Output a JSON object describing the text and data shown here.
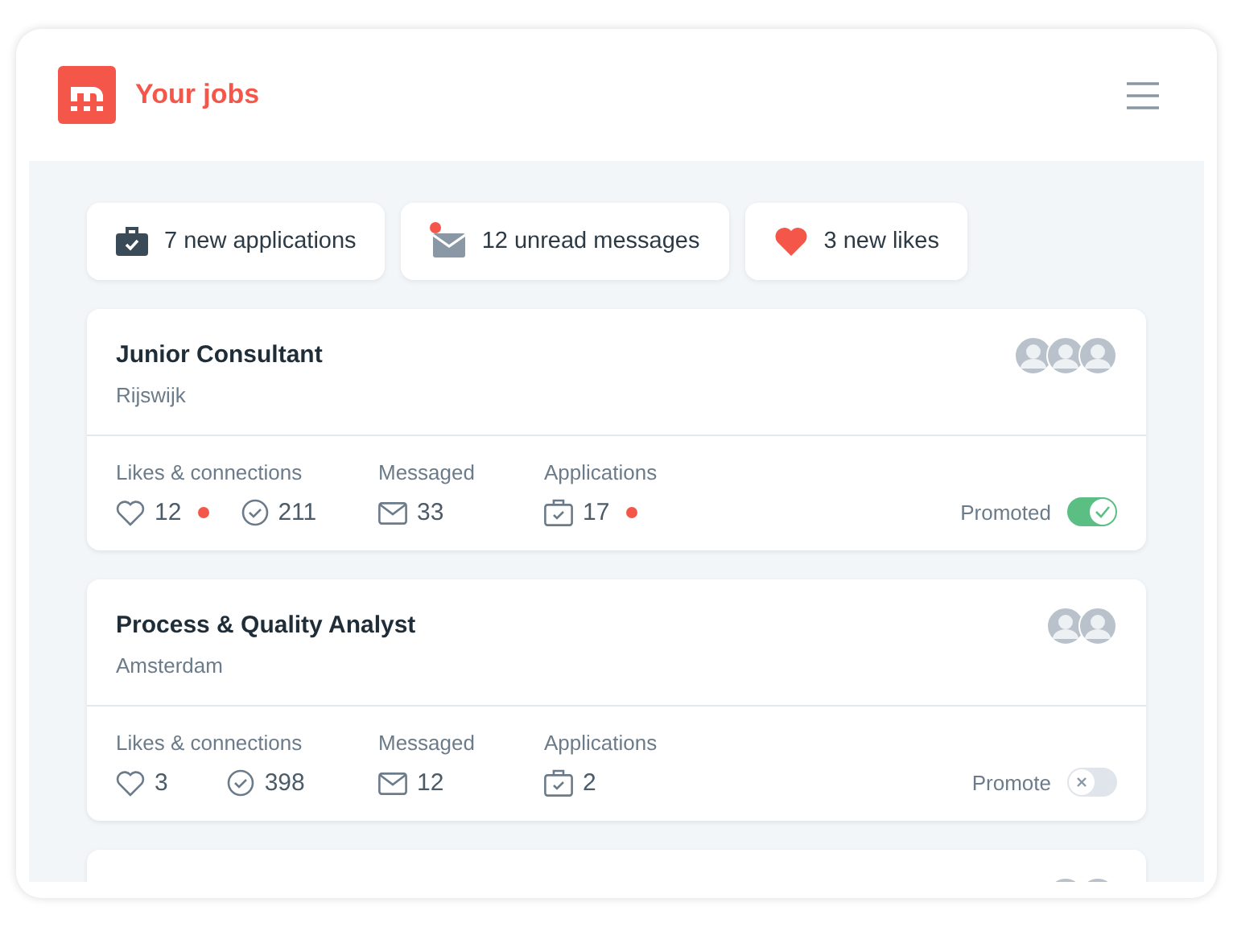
{
  "header": {
    "title": "Your jobs"
  },
  "summary": [
    {
      "kind": "applications",
      "label": "7 new applications",
      "unread": false
    },
    {
      "kind": "messages",
      "label": "12 unread messages",
      "unread": true
    },
    {
      "kind": "likes",
      "label": "3 new likes",
      "unread": false
    }
  ],
  "jobs": [
    {
      "labels": {
        "likes": "Likes & connections",
        "messaged": "Messaged",
        "applications": "Applications"
      },
      "title": "Junior Consultant",
      "location": "Rijswijk",
      "avatars": [
        {
          "kind": "photo"
        },
        {
          "kind": "photo"
        },
        {
          "kind": "photo"
        }
      ],
      "likes": "12",
      "likes_new": true,
      "connections": "211",
      "messaged": "33",
      "applications": "17",
      "applications_new": true,
      "promote_label": "Promoted",
      "promoted": true
    },
    {
      "labels": {
        "likes": "Likes & connections",
        "messaged": "Messaged",
        "applications": "Applications"
      },
      "title": "Process & Quality Analyst",
      "location": "Amsterdam",
      "avatars": [
        {
          "kind": "photo"
        },
        {
          "kind": "photo"
        }
      ],
      "likes": "3",
      "likes_new": false,
      "connections": "398",
      "messaged": "12",
      "applications": "2",
      "applications_new": false,
      "promote_label": "Promote",
      "promoted": false
    },
    {
      "avatars": [
        {
          "kind": "photo"
        },
        {
          "kind": "photo"
        }
      ]
    }
  ]
}
